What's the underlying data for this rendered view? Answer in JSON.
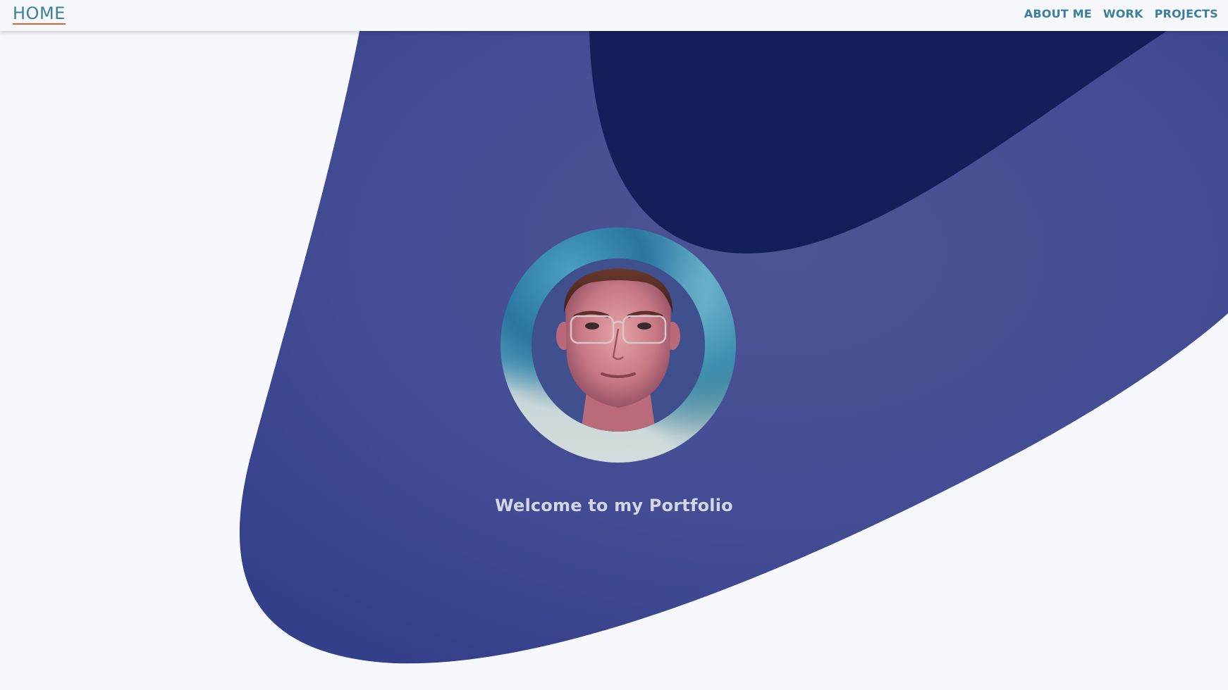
{
  "nav": {
    "home_label": "HOME",
    "items": [
      {
        "label": "ABOUT ME"
      },
      {
        "label": "WORK"
      },
      {
        "label": "PROJECTS"
      }
    ]
  },
  "hero": {
    "welcome_text": "Welcome to my Portfolio"
  },
  "colors": {
    "background": "#f7f8fd",
    "blob_main": "#3a4590",
    "blob_dark": "#141f5a",
    "accent_link": "#3c7f9c",
    "underline": "#d9652b"
  }
}
